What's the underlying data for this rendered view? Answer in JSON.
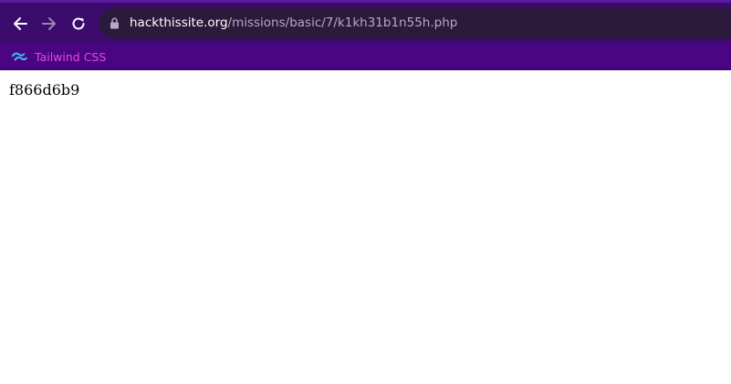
{
  "browser": {
    "url_host": "hackthissite.org",
    "url_path": "/missions/basic/7/k1kh31b1n55h.php",
    "icons": {
      "back": "back-arrow-icon",
      "forward": "forward-arrow-icon",
      "reload": "reload-icon",
      "lock": "lock-icon"
    },
    "colors": {
      "toolbar": "#3b0b6e",
      "urlbar": "#2c1a3a",
      "bookmarks_bar": "#4a0582",
      "bookmark_text": "#e24bd8"
    }
  },
  "bookmarks": [
    {
      "label": "Tailwind CSS",
      "icon": "tailwind-icon"
    }
  ],
  "page": {
    "text": "f866d6b9"
  }
}
